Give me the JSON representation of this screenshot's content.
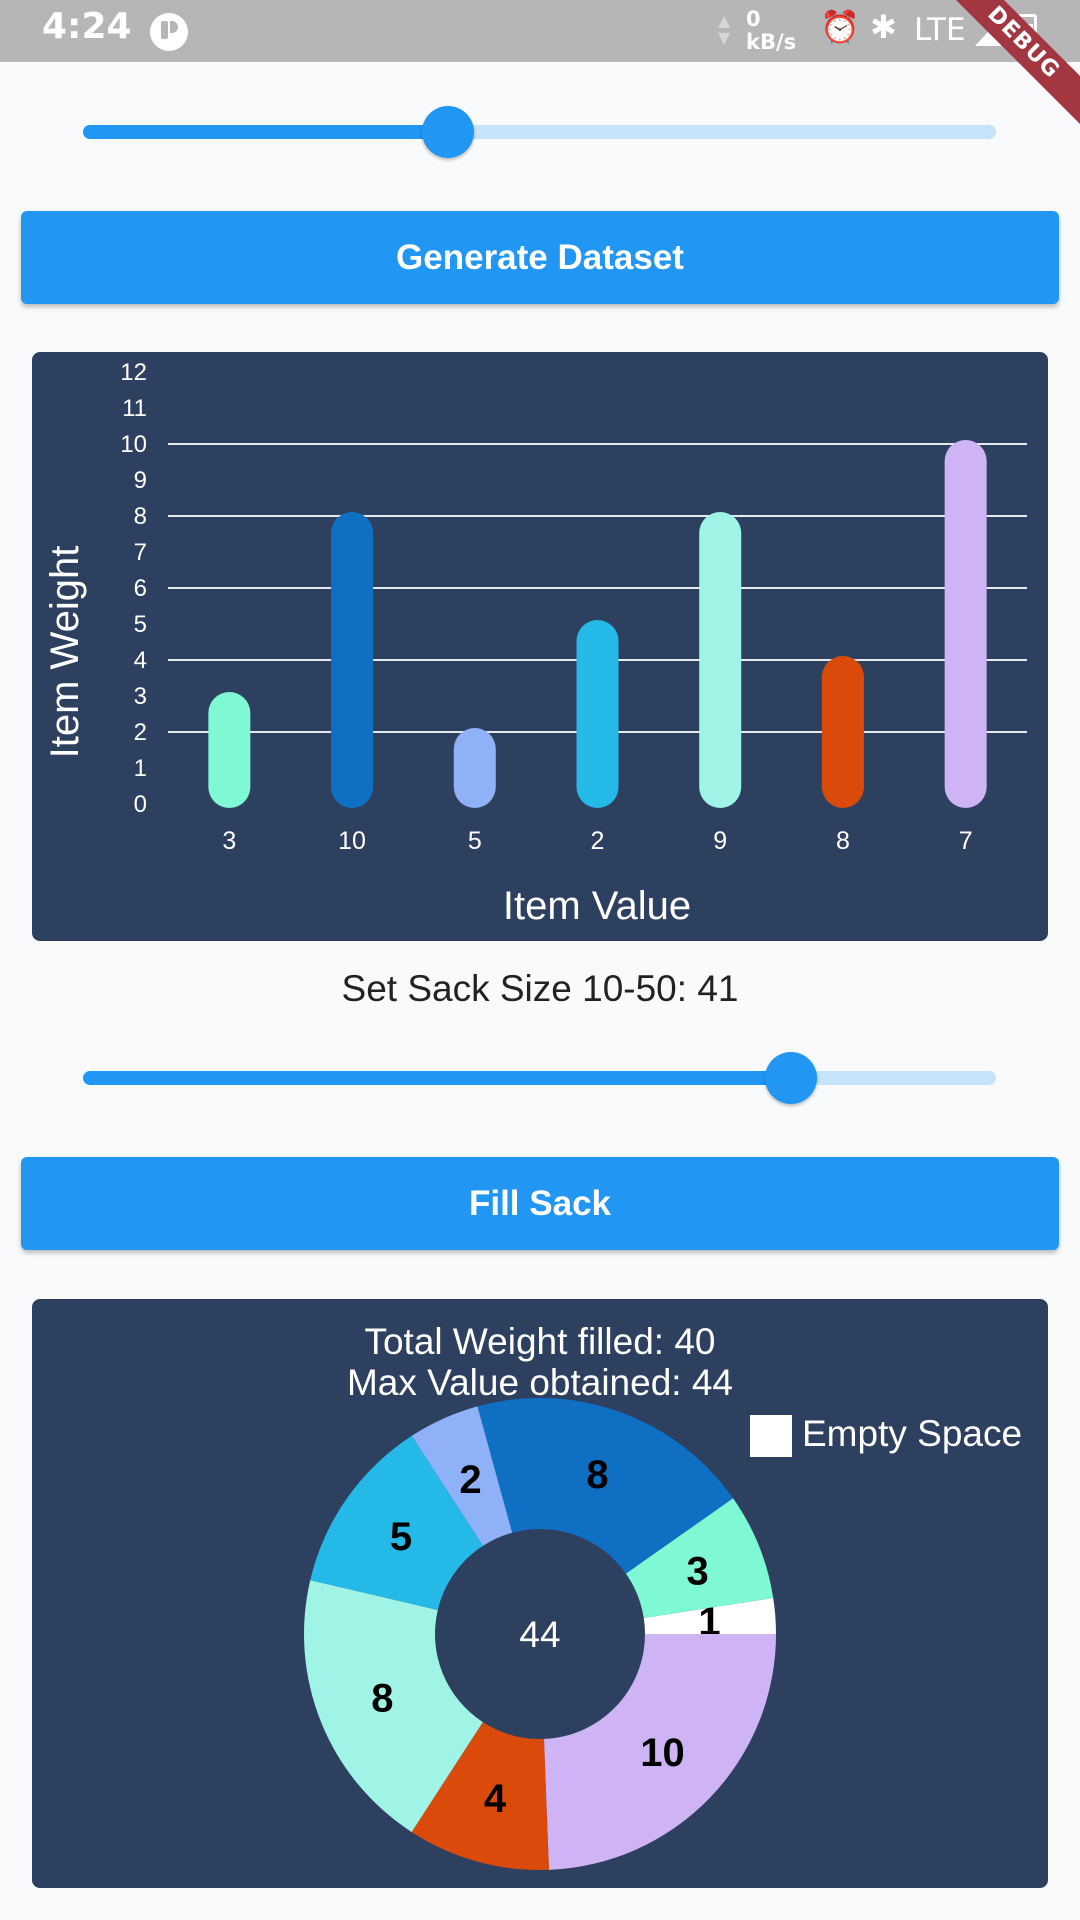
{
  "status_bar": {
    "time": "4:24",
    "net_speed_value": "0",
    "net_speed_unit": "kB/s",
    "network": "LTE",
    "icons": [
      "app-icon",
      "alarm-icon",
      "bluetooth-icon",
      "signal-icon",
      "battery-icon"
    ]
  },
  "debug_banner": "DEBUG",
  "dataset_slider": {
    "value_fraction": 0.4
  },
  "generate_button": {
    "label": "Generate Dataset"
  },
  "sack_slider": {
    "label": "Set Sack Size 10-50: 41",
    "min": 10,
    "max": 50,
    "value": 41
  },
  "fill_button": {
    "label": "Fill Sack"
  },
  "colors": {
    "accent": "#2196f3",
    "card_background": "#2e4060",
    "empty_space": "#ffffff"
  },
  "chart_data": [
    {
      "type": "bar",
      "categories": [
        "3",
        "10",
        "5",
        "2",
        "9",
        "8",
        "7"
      ],
      "values": [
        3,
        8,
        2,
        5,
        8,
        4,
        10
      ],
      "colors": [
        "#7ff8d4",
        "#0f6fc2",
        "#8fb1f8",
        "#25b9e7",
        "#9ff4e5",
        "#d94a0b",
        "#cfb4f5"
      ],
      "xlabel": "Item Value",
      "ylabel": "Item Weight",
      "ylim": [
        0,
        12
      ],
      "yticks": [
        "0",
        "1",
        "2",
        "3",
        "4",
        "5",
        "6",
        "7",
        "8",
        "9",
        "10",
        "11",
        "12"
      ],
      "gridlines": [
        2,
        4,
        6,
        8,
        10
      ]
    },
    {
      "type": "pie",
      "title_lines": [
        "Total Weight filled: 40",
        "Max Value obtained: 44"
      ],
      "center_text": "44",
      "legend": "Empty Space",
      "slices": [
        {
          "value": 1,
          "label": "1",
          "color": "#ffffff"
        },
        {
          "value": 3,
          "label": "3",
          "color": "#7ff8d4"
        },
        {
          "value": 8,
          "label": "8",
          "color": "#0f6fc2"
        },
        {
          "value": 2,
          "label": "2",
          "color": "#8fb1f8"
        },
        {
          "value": 5,
          "label": "5",
          "color": "#25b9e7"
        },
        {
          "value": 8,
          "label": "8",
          "color": "#9ff4e5"
        },
        {
          "value": 4,
          "label": "4",
          "color": "#d94a0b"
        },
        {
          "value": 10,
          "label": "10",
          "color": "#cfb4f5"
        }
      ]
    }
  ]
}
